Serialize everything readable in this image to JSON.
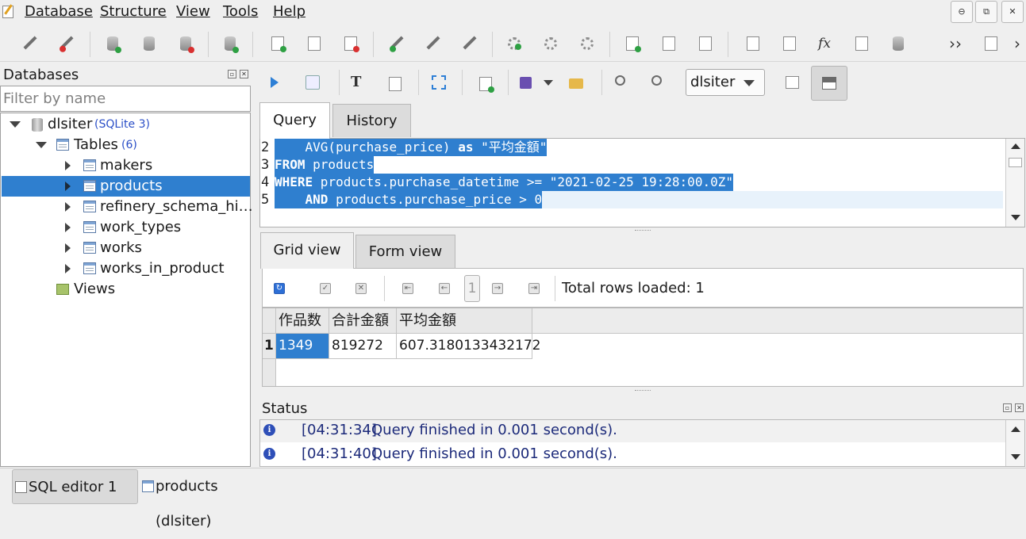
{
  "menu": {
    "items": [
      {
        "label": "Database"
      },
      {
        "label": "Structure"
      },
      {
        "label": "View"
      },
      {
        "label": "Tools"
      },
      {
        "label": "Help"
      }
    ]
  },
  "window_controls": [
    "minimize-icon",
    "restore-icon",
    "close-icon"
  ],
  "left_panel": {
    "title": "Databases",
    "filter_placeholder": "Filter by name",
    "tree": {
      "database": {
        "name": "dlsiter",
        "tag": "(SQLite 3)"
      },
      "tables": {
        "label": "Tables",
        "count": "(6)"
      },
      "table_items": [
        {
          "name": "makers"
        },
        {
          "name": "products"
        },
        {
          "name": "refinery_schema_hi…"
        },
        {
          "name": "work_types"
        },
        {
          "name": "works"
        },
        {
          "name": "works_in_product"
        }
      ],
      "views": {
        "label": "Views"
      }
    }
  },
  "sql_editor": {
    "db_selected": "dlsiter",
    "tabs": [
      {
        "label": "Query"
      },
      {
        "label": "History"
      }
    ],
    "lines": [
      {
        "num": "2",
        "parts": [
          {
            "t": "    AVG(purchase_price) "
          },
          {
            "t": "as",
            "kw": true
          },
          {
            "t": " \"平均金額\""
          }
        ]
      },
      {
        "num": "3",
        "parts": [
          {
            "t": "FROM",
            "kw": true
          },
          {
            "t": " products"
          }
        ]
      },
      {
        "num": "4",
        "parts": [
          {
            "t": "WHERE",
            "kw": true
          },
          {
            "t": " products.purchase_datetime >= \"2021-02-25 19:28:00.0Z\""
          }
        ]
      },
      {
        "num": "5",
        "parts": [
          {
            "t": "    "
          },
          {
            "t": "AND",
            "kw": true
          },
          {
            "t": " products.purchase_price > 0"
          }
        ]
      }
    ]
  },
  "results": {
    "tabs": [
      {
        "label": "Grid view"
      },
      {
        "label": "Form view"
      }
    ],
    "page_number": "1",
    "total_rows": "Total rows loaded: 1",
    "columns": [
      "作品数",
      "合計金額",
      "平均金額"
    ],
    "rows": [
      {
        "num": "1",
        "cells": [
          "1349",
          "819272",
          "607.3180133432172"
        ]
      }
    ]
  },
  "status": {
    "title": "Status",
    "messages": [
      {
        "time": "[04:31:34]",
        "text": "Query finished in 0.001 second(s)."
      },
      {
        "time": "[04:31:40]",
        "text": "Query finished in 0.001 second(s)."
      }
    ]
  },
  "bottom_tabs": [
    {
      "label": "SQL editor 1"
    },
    {
      "label": "products (dlsiter)"
    }
  ],
  "colors": {
    "selection": "#2f7fcf",
    "sqlite_tag": "#2b4fc7",
    "status_text": "#1c2a7a"
  }
}
